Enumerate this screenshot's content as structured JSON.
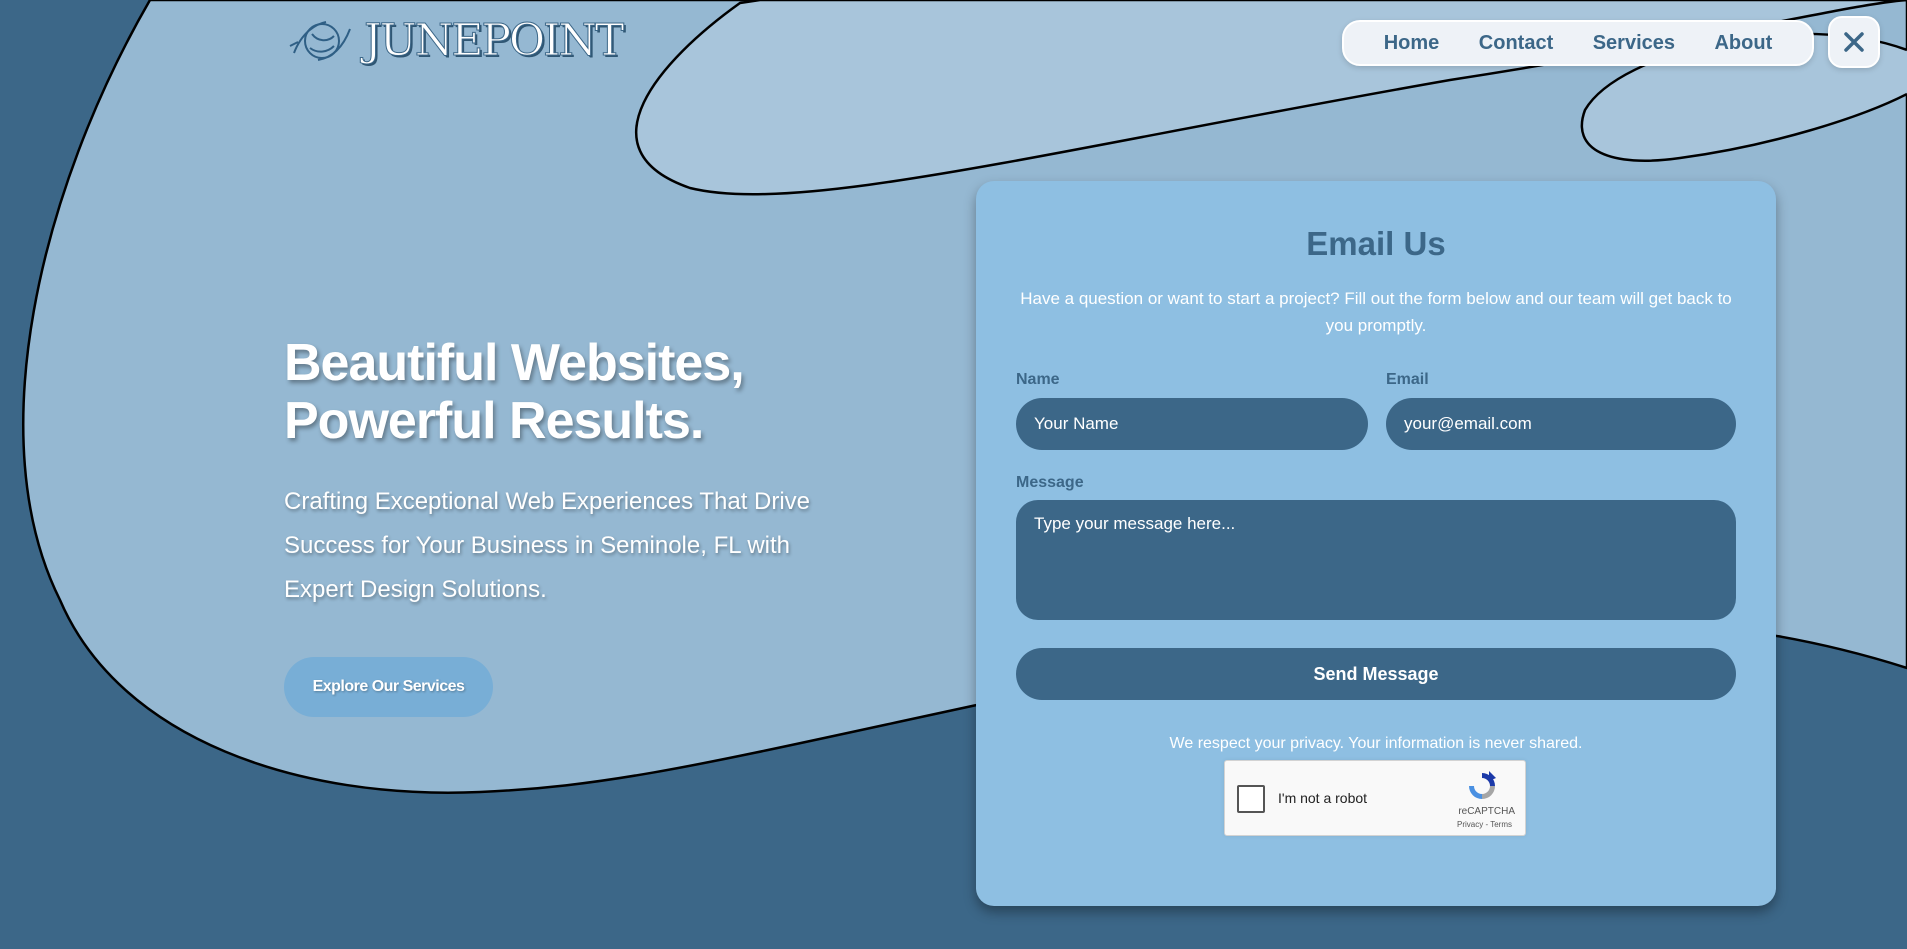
{
  "brand": {
    "logo_text": "JUNEPOINT",
    "logo_icon": "compass-globe-icon"
  },
  "nav": {
    "items": [
      {
        "label": "Home"
      },
      {
        "label": "Contact"
      },
      {
        "label": "Services"
      },
      {
        "label": "About"
      }
    ],
    "close_icon": "close-icon"
  },
  "hero": {
    "title_line1": "Beautiful Websites,",
    "title_line2": "Powerful Results.",
    "subtitle": "Crafting Exceptional Web Experiences That Drive Success for Your Business in Seminole, FL with Expert Design Solutions.",
    "cta_label": "Explore Our Services"
  },
  "form": {
    "title": "Email Us",
    "description": "Have a question or want to start a project? Fill out the form below and our team will get back to you promptly.",
    "name_label": "Name",
    "name_placeholder": "Your Name",
    "email_label": "Email",
    "email_placeholder": "your@email.com",
    "message_label": "Message",
    "message_placeholder": "Type your message here...",
    "submit_label": "Send Message",
    "privacy_note": "We respect your privacy. Your information is never shared."
  },
  "recaptcha": {
    "label": "I'm not a robot",
    "brand": "reCAPTCHA",
    "links": "Privacy - Terms",
    "icon": "recaptcha-icon"
  },
  "colors": {
    "page_bg": "#3c6788",
    "blob": "#95b8d2",
    "blob_light": "#a8c5db",
    "card_bg": "#8ebfe2",
    "accent_dark": "#3c6788",
    "cta_bg": "#78aed6"
  }
}
